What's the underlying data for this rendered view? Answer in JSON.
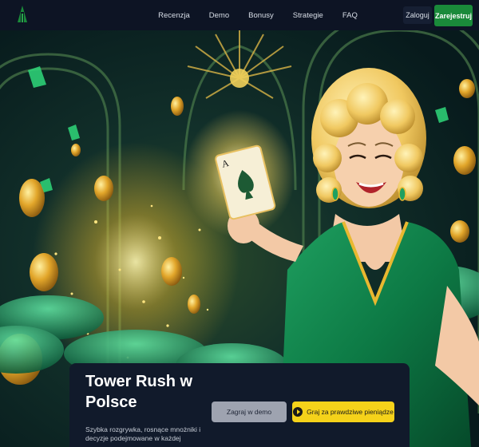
{
  "nav": {
    "items": [
      "Recenzja",
      "Demo",
      "Bonusy",
      "Strategie",
      "FAQ"
    ],
    "login_label": "Zaloguj",
    "register_label": "Zarejestruj"
  },
  "hero": {
    "title": "Tower Rush w Polsce",
    "description": "Szybka rozgrywka, rosnące mnożniki i decyzje podejmowane w każdej",
    "demo_button": "Zagraj w demo",
    "real_button": "Graj za prawdziwe pieniądze"
  },
  "colors": {
    "header_bg": "#0d1424",
    "accent_green": "#1a8a3a",
    "cta_yellow": "#f5d21a",
    "card_bg": "#111a2b"
  },
  "icons": [
    "logo-icon",
    "play-icon",
    "spade-card-icon"
  ]
}
